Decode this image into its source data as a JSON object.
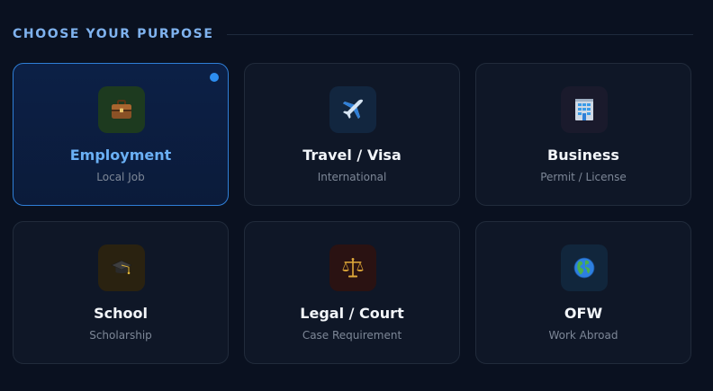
{
  "section": {
    "title": "CHOOSE YOUR PURPOSE"
  },
  "purposes": [
    {
      "title": "Employment",
      "subtitle": "Local Job",
      "icon": "briefcase-icon",
      "selected": true
    },
    {
      "title": "Travel / Visa",
      "subtitle": "International",
      "icon": "airplane-icon",
      "selected": false
    },
    {
      "title": "Business",
      "subtitle": "Permit / License",
      "icon": "office-building-icon",
      "selected": false
    },
    {
      "title": "School",
      "subtitle": "Scholarship",
      "icon": "graduation-cap-icon",
      "selected": false
    },
    {
      "title": "Legal / Court",
      "subtitle": "Case Requirement",
      "icon": "balance-scale-icon",
      "selected": false
    },
    {
      "title": "OFW",
      "subtitle": "Work Abroad",
      "icon": "globe-icon",
      "selected": false
    }
  ],
  "colors": {
    "background": "#0a1120",
    "accent": "#2d8ef0",
    "selected_title": "#6ab0f5",
    "header": "#7fb2ee"
  }
}
